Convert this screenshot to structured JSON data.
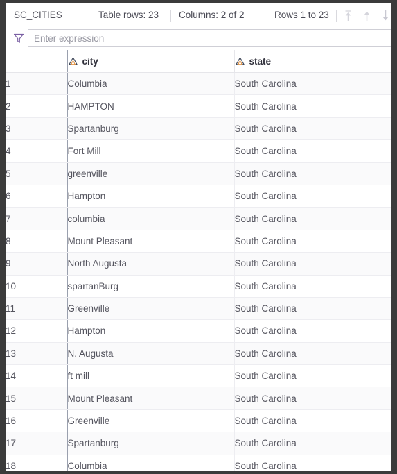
{
  "window": {
    "frame_color": "#3b3b3b",
    "panel_background": "#ffffff"
  },
  "toolbar": {
    "table_name": "SC_CITIES",
    "table_rows_label": "Table rows: 23",
    "columns_label": "Columns: 2 of 2",
    "rows_range_label": "Rows 1 to 23",
    "icons": [
      {
        "name": "go-to-first-row-icon",
        "glyph": "arrow-up-to-bar",
        "color": "#d5d5dc"
      },
      {
        "name": "previous-row-icon",
        "glyph": "arrow-up",
        "color": "#d5d5dc"
      },
      {
        "name": "next-row-icon",
        "glyph": "arrow-down",
        "color": "#c9c9d2"
      }
    ]
  },
  "filter": {
    "icon": "filter-funnel-icon",
    "placeholder": "Enter expression",
    "value": ""
  },
  "table": {
    "row_number_header": "",
    "columns": [
      {
        "label": "city",
        "type_icon": "string-type-icon"
      },
      {
        "label": "state",
        "type_icon": "string-type-icon"
      }
    ],
    "rows": [
      {
        "n": "1",
        "city": "Columbia",
        "state": "South Carolina"
      },
      {
        "n": "2",
        "city": "HAMPTON",
        "state": "South Carolina"
      },
      {
        "n": "3",
        "city": "Spartanburg",
        "state": "South Carolina"
      },
      {
        "n": "4",
        "city": "Fort Mill",
        "state": "South Carolina"
      },
      {
        "n": "5",
        "city": "greenville",
        "state": "South Carolina"
      },
      {
        "n": "6",
        "city": "Hampton",
        "state": "South Carolina"
      },
      {
        "n": "7",
        "city": "columbia",
        "state": "South Carolina"
      },
      {
        "n": "8",
        "city": "Mount Pleasant",
        "state": "South Carolina"
      },
      {
        "n": "9",
        "city": "North Augusta",
        "state": "South Carolina"
      },
      {
        "n": "10",
        "city": "spartanBurg",
        "state": "South Carolina"
      },
      {
        "n": "11",
        "city": "Greenville",
        "state": "South Carolina"
      },
      {
        "n": "12",
        "city": "Hampton",
        "state": "South Carolina"
      },
      {
        "n": "13",
        "city": "N. Augusta",
        "state": "South Carolina"
      },
      {
        "n": "14",
        "city": "ft mill",
        "state": "South Carolina"
      },
      {
        "n": "15",
        "city": "Mount Pleasant",
        "state": "South Carolina"
      },
      {
        "n": "16",
        "city": "Greenville",
        "state": "South Carolina"
      },
      {
        "n": "17",
        "city": "Spartanburg",
        "state": "South Carolina"
      },
      {
        "n": "18",
        "city": "Columbia",
        "state": "South Carolina"
      }
    ]
  }
}
